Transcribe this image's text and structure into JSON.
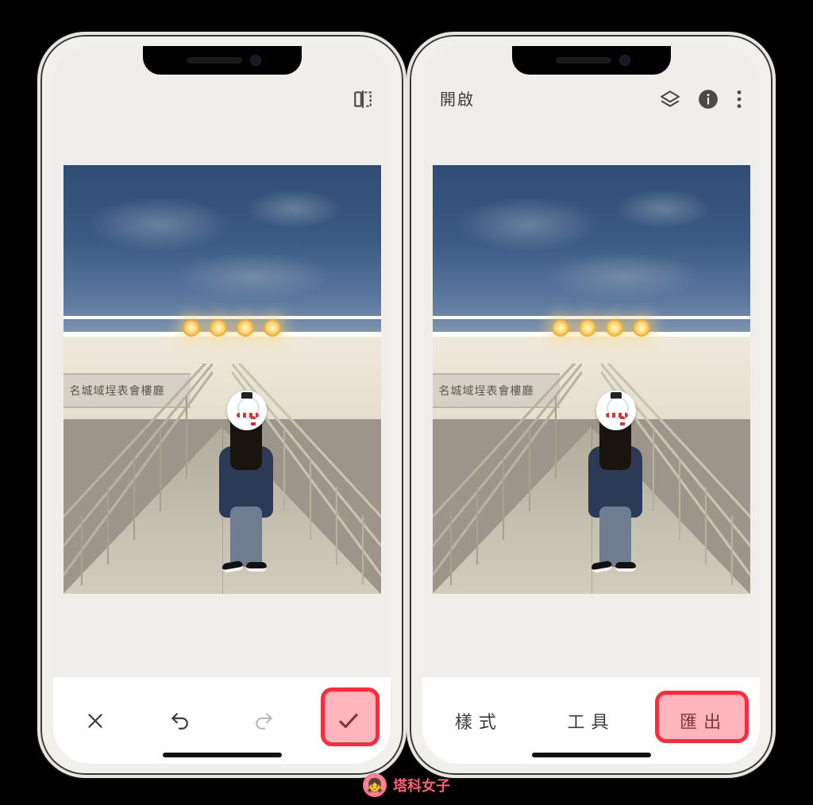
{
  "left_phone": {
    "topbar": {
      "compare_icon": "compare-icon"
    },
    "image": {
      "sign_text": "名城域埕表會樓廳"
    },
    "bottombar": {
      "close": "✕",
      "undo": "↶",
      "redo": "↷",
      "confirm": "✓"
    },
    "highlight_target": "confirm-button"
  },
  "right_phone": {
    "topbar": {
      "open_label": "開啟",
      "layers_icon": "layers-icon",
      "info_icon": "info-icon",
      "more_icon": "more-icon"
    },
    "image": {
      "sign_text": "名城域埕表會樓廳"
    },
    "bottombar": {
      "styles": "樣式",
      "tools": "工具",
      "export": "匯出"
    },
    "highlight_target": "export-button"
  },
  "watermark": {
    "text": "塔科女子",
    "emoji": "👧"
  }
}
